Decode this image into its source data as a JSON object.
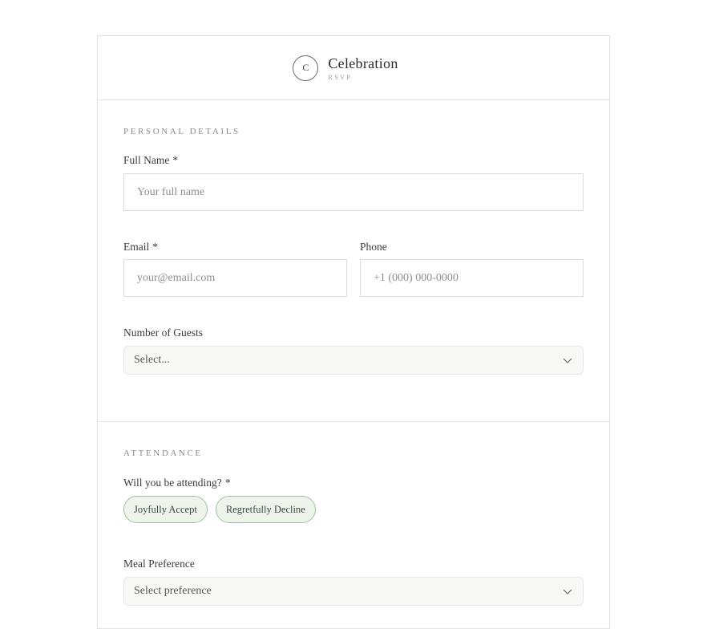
{
  "brand": {
    "logo_letter": "C",
    "title": "Celebration",
    "subtitle": "RSVP"
  },
  "personal": {
    "title": "PERSONAL DETAILS",
    "full_name": {
      "label": "Full Name",
      "required_mark": "*",
      "placeholder": "Your full name"
    },
    "email": {
      "label": "Email",
      "required_mark": "*",
      "placeholder": "your@email.com"
    },
    "phone": {
      "label": "Phone",
      "placeholder": "+1 (000) 000-0000"
    },
    "guests": {
      "label": "Number of Guests",
      "selected": "Select..."
    }
  },
  "attendance": {
    "title": "ATTENDANCE",
    "question": "Will you be attending?",
    "required_mark": "*",
    "accept": "Joyfully Accept",
    "decline": "Regretfully Decline",
    "meal": {
      "label": "Meal Preference",
      "selected": "Select preference"
    }
  },
  "colors": {
    "pill_border": "#9fbf9f",
    "pill_bg": "#eef4ec",
    "border": "#e3e3e3"
  }
}
